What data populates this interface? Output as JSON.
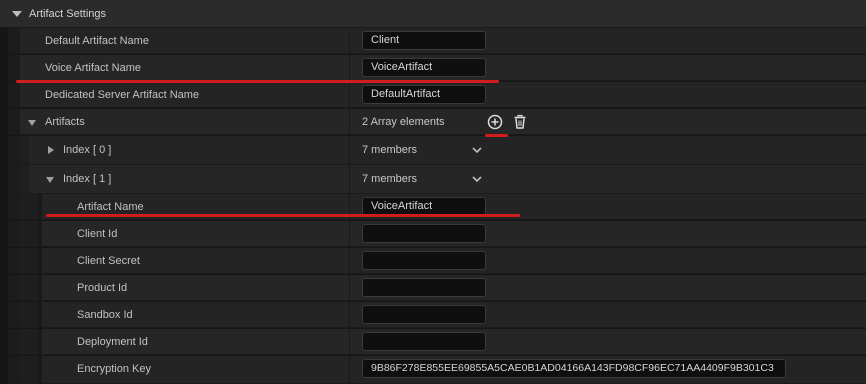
{
  "section": {
    "title": "Artifact Settings"
  },
  "fields": {
    "default_artifact_name": {
      "label": "Default Artifact Name",
      "value": "Client"
    },
    "voice_artifact_name": {
      "label": "Voice Artifact Name",
      "value": "VoiceArtifact"
    },
    "dedicated_server_artifact_name": {
      "label": "Dedicated Server Artifact Name",
      "value": "DefaultArtifact"
    }
  },
  "artifacts": {
    "label": "Artifacts",
    "count_text": "2 Array elements",
    "index0": {
      "label": "Index [ 0 ]",
      "members": "7 members"
    },
    "index1": {
      "label": "Index [ 1 ]",
      "members": "7 members"
    }
  },
  "index1_fields": {
    "artifact_name": {
      "label": "Artifact Name",
      "value": "VoiceArtifact"
    },
    "client_id": {
      "label": "Client Id",
      "value": ""
    },
    "client_secret": {
      "label": "Client Secret",
      "value": ""
    },
    "product_id": {
      "label": "Product Id",
      "value": ""
    },
    "sandbox_id": {
      "label": "Sandbox Id",
      "value": ""
    },
    "deployment_id": {
      "label": "Deployment Id",
      "value": ""
    },
    "encryption_key": {
      "label": "Encryption Key",
      "value": "9B86F278E855EE69855A5CAE0B1AD04166A143FD98CF96EC71AA4409F9B301C3"
    }
  },
  "colors": {
    "annotation_red": "#d01e1e",
    "background": "#242424",
    "field_bg": "#0f0f0f"
  },
  "icons": [
    "collapse-triangle-icon",
    "expand-triangle-icon",
    "chevron-down-icon",
    "add-circle-icon",
    "trash-icon"
  ]
}
